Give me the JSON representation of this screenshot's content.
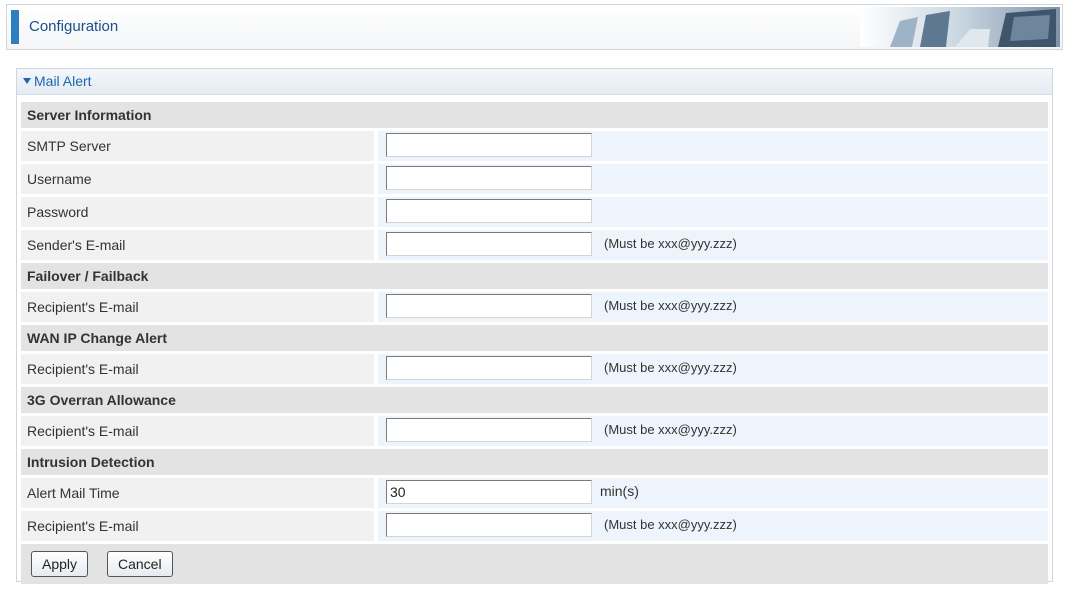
{
  "header": {
    "title": "Configuration"
  },
  "panel": {
    "title": "Mail Alert"
  },
  "sections": [
    {
      "heading": "Server Information",
      "rows": [
        {
          "label": "SMTP Server",
          "value": "",
          "hint": ""
        },
        {
          "label": "Username",
          "value": "",
          "hint": ""
        },
        {
          "label": "Password",
          "value": "",
          "hint": ""
        },
        {
          "label": "Sender's E-mail",
          "value": "",
          "hint": "(Must be xxx@yyy.zzz)"
        }
      ]
    },
    {
      "heading": "Failover / Failback",
      "rows": [
        {
          "label": "Recipient's E-mail",
          "value": "",
          "hint": "(Must be xxx@yyy.zzz)"
        }
      ]
    },
    {
      "heading": "WAN IP Change Alert",
      "rows": [
        {
          "label": "Recipient's E-mail",
          "value": "",
          "hint": "(Must be xxx@yyy.zzz)"
        }
      ]
    },
    {
      "heading": "3G Overran Allowance",
      "rows": [
        {
          "label": "Recipient's E-mail",
          "value": "",
          "hint": "(Must be xxx@yyy.zzz)"
        }
      ]
    },
    {
      "heading": "Intrusion Detection",
      "rows": [
        {
          "label": "Alert Mail Time",
          "value": "30",
          "hint": "min(s)"
        },
        {
          "label": "Recipient's E-mail",
          "value": "",
          "hint": "(Must be xxx@yyy.zzz)"
        }
      ]
    }
  ],
  "buttons": {
    "apply": "Apply",
    "cancel": "Cancel"
  },
  "colors": {
    "accent": "#2e7fc0",
    "panel_title": "#1a66b0",
    "section_bg": "#e3e3e3",
    "value_bg": "#eef4fb"
  }
}
